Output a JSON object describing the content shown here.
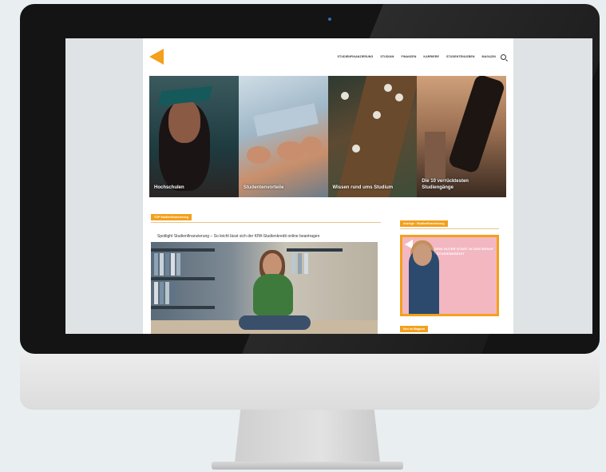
{
  "nav": {
    "items": [
      "STUDIENFINANZIERUNG",
      "STUDIUM",
      "FINANZEN",
      "KARRIERE",
      "STUDENTENLEBEN",
      "MAGAZIN"
    ]
  },
  "features": [
    {
      "caption": "Hochschulen",
      "icon": "graduation-photo"
    },
    {
      "caption": "Studentenvorteile",
      "icon": "money-photo"
    },
    {
      "caption": "Wissen rund ums Studium",
      "icon": "cafe-photo"
    },
    {
      "caption": "Die 10 verrücktesten Studiengänge",
      "icon": "walking-photo"
    }
  ],
  "main": {
    "section_label": "TOP Studienfinanzierung",
    "post_title": "Spotlight Studienfinanzierung – So leicht lässt sich der KfW-Studienkredit online beantragen"
  },
  "sidebar": {
    "section_label": "Anzeige · Studienfinanzierung",
    "ad_text": "DEIN GUTER START IN DEN BERUF · STUDIENKREDIT",
    "section_label_2": "Neu im Magazin"
  },
  "colors": {
    "accent": "#f4a01c",
    "ad_background": "#f3b7c1",
    "monitor_bezel": "#141414"
  }
}
